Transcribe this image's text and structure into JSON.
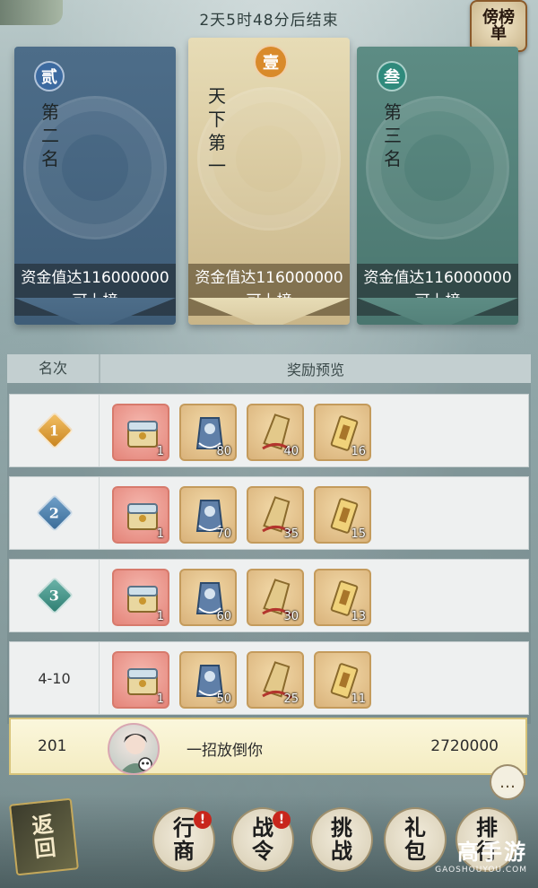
{
  "header": {
    "countdown": "2天5时48分后结束",
    "rank_list_label": "傍榜单"
  },
  "podium": [
    {
      "badge": "贰",
      "title": "第二名",
      "requirement": "资金值达116000000",
      "requirement_2": "可上榜"
    },
    {
      "badge": "壹",
      "title": "天下第一",
      "requirement": "资金值达116000000",
      "requirement_2": "可上榜"
    },
    {
      "badge": "叁",
      "title": "第三名",
      "requirement": "资金值达116000000",
      "requirement_2": "可上榜"
    }
  ],
  "table": {
    "col_rank": "名次",
    "col_reward": "奖励预览",
    "rows": [
      {
        "rank": "1",
        "rank_text": "",
        "items": [
          "1",
          "80",
          "40",
          "16"
        ]
      },
      {
        "rank": "2",
        "rank_text": "",
        "items": [
          "1",
          "70",
          "35",
          "15"
        ]
      },
      {
        "rank": "3",
        "rank_text": "",
        "items": [
          "1",
          "60",
          "30",
          "13"
        ]
      },
      {
        "rank": "",
        "rank_text": "4-10",
        "items": [
          "1",
          "50",
          "25",
          "11"
        ]
      }
    ]
  },
  "self": {
    "rank": "201",
    "name": "一招放倒你",
    "value": "2720000"
  },
  "nav": {
    "back": "返回",
    "buttons": [
      "行商",
      "战令",
      "挑战",
      "礼包",
      "排行"
    ],
    "alerts": [
      "!",
      "!"
    ]
  },
  "watermark": {
    "title": "高手游",
    "url": "GAOSHOUYOU.COM"
  },
  "colors": {
    "second": "#4d6d89",
    "first": "#e7dcb6",
    "third": "#5d8c84",
    "self_row": "#fbf7dc"
  }
}
